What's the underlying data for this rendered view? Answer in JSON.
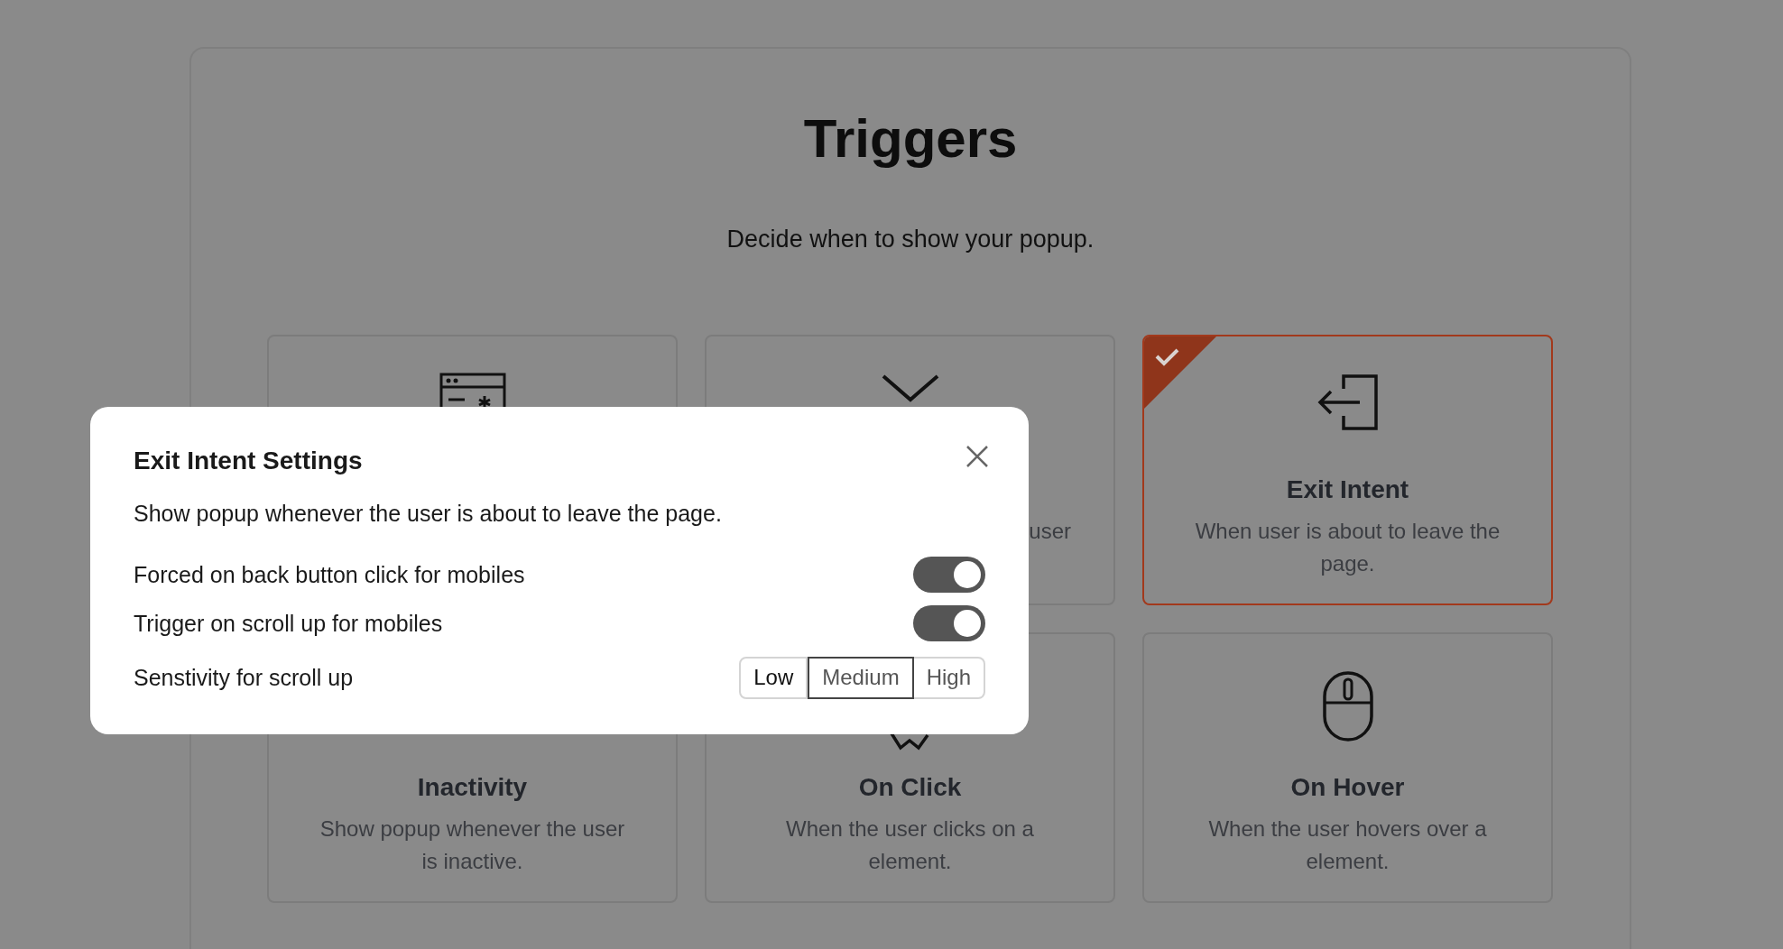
{
  "page": {
    "title": "Triggers",
    "subtitle": "Decide when to show your popup."
  },
  "cards": [
    {
      "kind": "browser",
      "selected": false
    },
    {
      "kind": "chevron",
      "description": "user",
      "selected": false
    },
    {
      "kind": "exit",
      "title": "Exit Intent",
      "description": "When user is about to leave the page.",
      "selected": true
    },
    {
      "title": "Inactivity",
      "description": "Show popup whenever the user is inactive.",
      "selected": false
    },
    {
      "kind": "fragment",
      "title": "On Click",
      "description": "When the user clicks on a element.",
      "selected": false
    },
    {
      "kind": "mouse",
      "title": "On Hover",
      "description": "When the user hovers over a element.",
      "selected": false
    }
  ],
  "modal": {
    "title": "Exit Intent Settings",
    "description": "Show popup whenever the user is about to leave the page.",
    "settings": [
      {
        "kind": "toggle",
        "label": "Forced on back button click for mobiles",
        "on": true
      },
      {
        "kind": "toggle",
        "label": "Trigger on scroll up for mobiles",
        "on": true
      },
      {
        "kind": "segmented",
        "label": "Senstivity for scroll up",
        "options": [
          {
            "label": "Low",
            "selected": false
          },
          {
            "label": "Medium",
            "selected": true
          },
          {
            "label": "High",
            "selected": false
          }
        ]
      }
    ]
  }
}
